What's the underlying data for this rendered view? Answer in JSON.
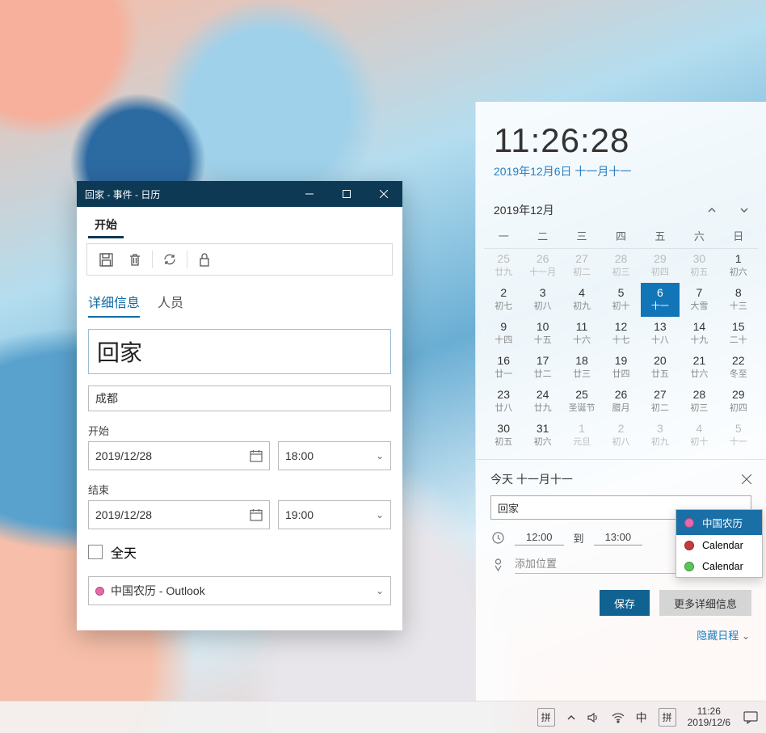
{
  "dialog": {
    "title": "回家 - 事件 - 日历",
    "ribbonTab": "开始",
    "tabs": {
      "details": "详细信息",
      "people": "人员"
    },
    "eventTitle": "回家",
    "location": "成都",
    "startLabel": "开始",
    "startDate": "2019/12/28",
    "startTime": "18:00",
    "endLabel": "结束",
    "endDate": "2019/12/28",
    "endTime": "19:00",
    "allDay": "全天",
    "calendarSelect": "中国农历 - Outlook",
    "calendarDotColor": "#e66aa9"
  },
  "flyout": {
    "bigTime": "11:26:28",
    "bigDate": "2019年12月6日 十一月十一",
    "monthLabel": "2019年12月",
    "weekdays": [
      "一",
      "二",
      "三",
      "四",
      "五",
      "六",
      "日"
    ],
    "weeks": [
      [
        {
          "d": "25",
          "l": "廿九",
          "dim": true
        },
        {
          "d": "26",
          "l": "十一月",
          "dim": true
        },
        {
          "d": "27",
          "l": "初二",
          "dim": true
        },
        {
          "d": "28",
          "l": "初三",
          "dim": true
        },
        {
          "d": "29",
          "l": "初四",
          "dim": true
        },
        {
          "d": "30",
          "l": "初五",
          "dim": true
        },
        {
          "d": "1",
          "l": "初六"
        }
      ],
      [
        {
          "d": "2",
          "l": "初七"
        },
        {
          "d": "3",
          "l": "初八"
        },
        {
          "d": "4",
          "l": "初九"
        },
        {
          "d": "5",
          "l": "初十"
        },
        {
          "d": "6",
          "l": "十一",
          "today": true
        },
        {
          "d": "7",
          "l": "大雪"
        },
        {
          "d": "8",
          "l": "十三"
        }
      ],
      [
        {
          "d": "9",
          "l": "十四"
        },
        {
          "d": "10",
          "l": "十五"
        },
        {
          "d": "11",
          "l": "十六"
        },
        {
          "d": "12",
          "l": "十七"
        },
        {
          "d": "13",
          "l": "十八"
        },
        {
          "d": "14",
          "l": "十九"
        },
        {
          "d": "15",
          "l": "二十"
        }
      ],
      [
        {
          "d": "16",
          "l": "廿一"
        },
        {
          "d": "17",
          "l": "廿二"
        },
        {
          "d": "18",
          "l": "廿三"
        },
        {
          "d": "19",
          "l": "廿四"
        },
        {
          "d": "20",
          "l": "廿五"
        },
        {
          "d": "21",
          "l": "廿六"
        },
        {
          "d": "22",
          "l": "冬至"
        }
      ],
      [
        {
          "d": "23",
          "l": "廿八"
        },
        {
          "d": "24",
          "l": "廿九"
        },
        {
          "d": "25",
          "l": "圣诞节"
        },
        {
          "d": "26",
          "l": "腊月"
        },
        {
          "d": "27",
          "l": "初二"
        },
        {
          "d": "28",
          "l": "初三"
        },
        {
          "d": "29",
          "l": "初四"
        }
      ],
      [
        {
          "d": "30",
          "l": "初五"
        },
        {
          "d": "31",
          "l": "初六"
        },
        {
          "d": "1",
          "l": "元旦",
          "dim": true
        },
        {
          "d": "2",
          "l": "初八",
          "dim": true
        },
        {
          "d": "3",
          "l": "初九",
          "dim": true
        },
        {
          "d": "4",
          "l": "初十",
          "dim": true
        },
        {
          "d": "5",
          "l": "十一",
          "dim": true
        }
      ]
    ],
    "agendaHeader": "今天 十一月十一",
    "agendaTitle": "回家",
    "timeFrom": "12:00",
    "timeSep": "到",
    "timeTo": "13:00",
    "locationPlaceholder": "添加位置",
    "saveBtn": "保存",
    "moreBtn": "更多详细信息",
    "hide": "隐藏日程"
  },
  "calmenu": {
    "items": [
      {
        "label": "中国农历",
        "color": "#e66aa9",
        "selected": true
      },
      {
        "label": "Calendar",
        "color": "#c63a3a"
      },
      {
        "label": "Calendar",
        "color": "#58c658"
      }
    ]
  },
  "taskbar": {
    "ime1": "拼",
    "up": "ᐱ",
    "vol": "🔈",
    "wifi": "⌔",
    "cn": "中",
    "ime2": "拼",
    "time": "11:26",
    "date": "2019/12/6"
  }
}
